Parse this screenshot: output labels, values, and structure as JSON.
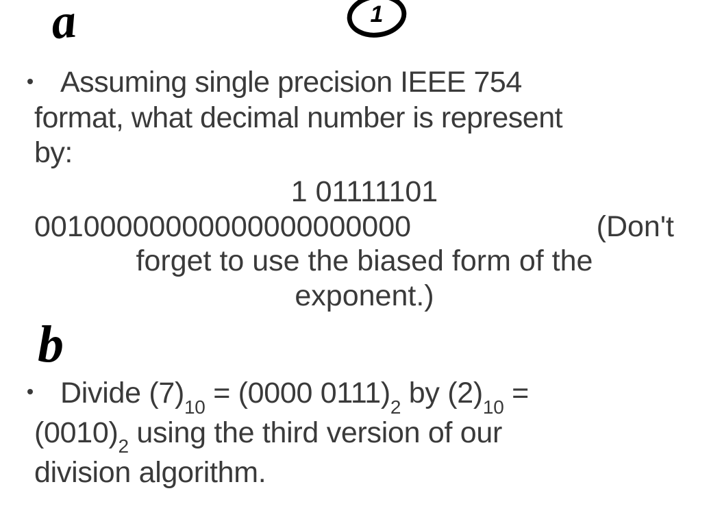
{
  "annotations": {
    "a": "a",
    "circled": "1",
    "b": "b"
  },
  "question_a": {
    "line1_indent": "Assuming single precision IEEE 754",
    "line2": "format, what decimal number is represent",
    "line3": "by:",
    "binary1": "1 01111101",
    "binary2": "00100000000000000000000",
    "note_part1": "(Don't",
    "note_line2": "forget to use the biased form of the",
    "note_line3": "exponent.)"
  },
  "question_b": {
    "prefix": "Divide (7)",
    "sub1": "10",
    "mid1": " = (0000 0111)",
    "sub2": "2",
    "mid2": " by (2)",
    "sub3": "10",
    "mid3": " =",
    "line2_start": "(0010)",
    "sub4": "2",
    "line2_rest": " using the third version of our",
    "line3": "division algorithm."
  }
}
